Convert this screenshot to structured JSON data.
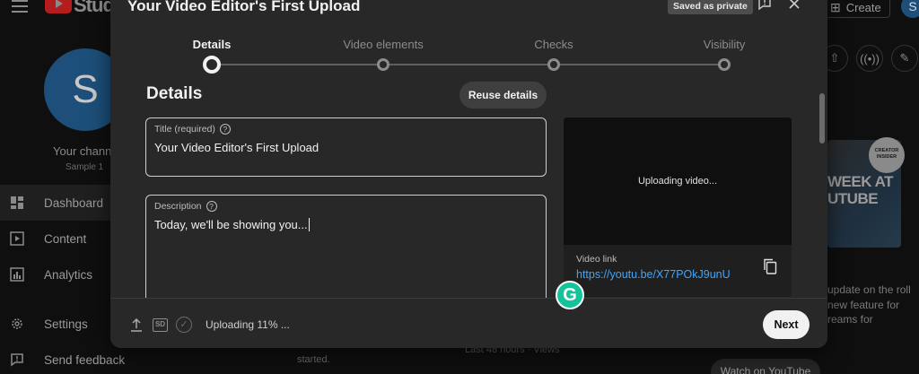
{
  "background": {
    "brand": "Studio",
    "create_label": "Create",
    "avatar_letter": "S",
    "channel": {
      "avatar_letter": "S",
      "name": "Your chann",
      "sub": "Sample 1"
    },
    "nav": [
      {
        "label": "Dashboard",
        "icon": "dashboard-icon",
        "active": true
      },
      {
        "label": "Content",
        "icon": "content-icon",
        "active": false
      },
      {
        "label": "Analytics",
        "icon": "analytics-icon",
        "active": false
      },
      {
        "label": "Settings",
        "icon": "gear-icon",
        "active": false
      },
      {
        "label": "Send feedback",
        "icon": "feedback-icon",
        "active": false
      }
    ],
    "creator_badge": "CREATOR INSIDER",
    "thumb_text": "WEEK AT UTUBE",
    "news_lines": [
      "update on the roll",
      "new feature for",
      "reams for"
    ],
    "watch_button": "Watch on YouTube",
    "started_text": "started.",
    "views_text": "Last 48 hours · Views"
  },
  "dialog": {
    "title": "Your Video Editor's First Upload",
    "saved_chip": "Saved as private",
    "steps": [
      {
        "label": "Details",
        "active": true
      },
      {
        "label": "Video elements",
        "active": false
      },
      {
        "label": "Checks",
        "active": false
      },
      {
        "label": "Visibility",
        "active": false
      }
    ],
    "section_title": "Details",
    "reuse_button": "Reuse details",
    "title_field": {
      "label": "Title (required)",
      "value": "Your Video Editor's First Upload"
    },
    "description_field": {
      "label": "Description",
      "value": "Today, we'll be showing you..."
    },
    "preview": {
      "status": "Uploading video...",
      "link_label": "Video link",
      "link_url": "https://youtu.be/X77POkJ9unU"
    },
    "footer": {
      "sd_badge": "SD",
      "upload_status": "Uploading 11% ...",
      "upload_progress_percent": 11,
      "next_button": "Next"
    }
  },
  "overlay": {
    "grammarly_letter": "G"
  },
  "colors": {
    "accent_link": "#3ea6ff",
    "dialog_bg": "#282828",
    "page_bg": "#0f0f0f",
    "grammarly": "#15c39a"
  }
}
